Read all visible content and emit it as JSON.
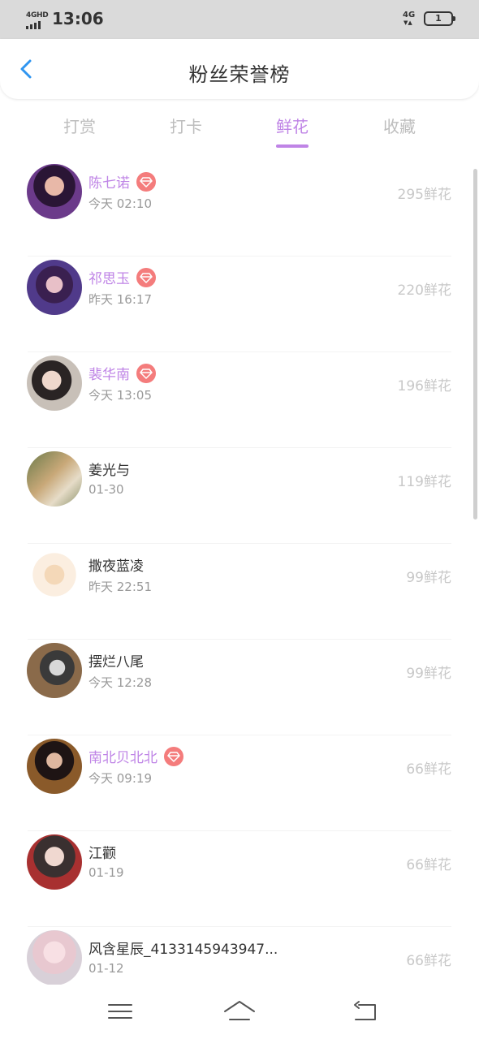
{
  "status_bar": {
    "network_left": "4GHD",
    "time": "13:06",
    "network_right": "4G",
    "battery": "1"
  },
  "header": {
    "title": "粉丝荣誉榜"
  },
  "tabs": [
    {
      "label": "打赏",
      "active": false
    },
    {
      "label": "打卡",
      "active": false
    },
    {
      "label": "鲜花",
      "active": true
    },
    {
      "label": "收藏",
      "active": false
    }
  ],
  "fans": [
    {
      "name": "陈七诺",
      "vip": true,
      "time": "今天 02:10",
      "count": "295鲜花"
    },
    {
      "name": "祁思玉",
      "vip": true,
      "time": "昨天 16:17",
      "count": "220鲜花"
    },
    {
      "name": "裴华南",
      "vip": true,
      "time": "今天 13:05",
      "count": "196鲜花"
    },
    {
      "name": "姜光与",
      "vip": false,
      "time": "01-30",
      "count": "119鲜花"
    },
    {
      "name": "撒夜蓝凌",
      "vip": false,
      "time": "昨天 22:51",
      "count": "99鲜花"
    },
    {
      "name": "摆烂八尾",
      "vip": false,
      "time": "今天 12:28",
      "count": "99鲜花"
    },
    {
      "name": "南北贝北北",
      "vip": true,
      "time": "今天 09:19",
      "count": "66鲜花"
    },
    {
      "name": "江颧",
      "vip": false,
      "time": "01-19",
      "count": "66鲜花"
    },
    {
      "name": "风含星辰_4133145943947...",
      "vip": false,
      "time": "01-12",
      "count": "66鲜花"
    }
  ],
  "colors": {
    "accent": "#bf84e6",
    "vip_badge": "#f47c7c",
    "back_arrow": "#2f95f0"
  }
}
